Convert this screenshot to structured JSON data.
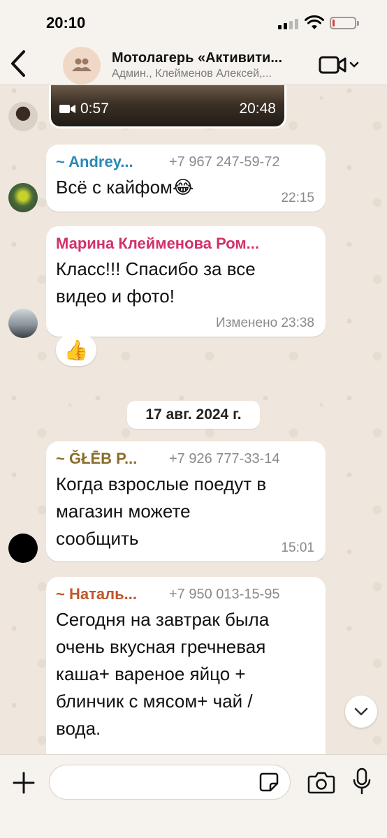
{
  "status_bar": {
    "time": "20:10",
    "battery_level": 0.1
  },
  "header": {
    "title": "Мотолагерь «Активити...",
    "subtitle": "Админ., Клейменов Алексей,..."
  },
  "colors": {
    "andrey": "#2a8ab5",
    "marina": "#d2306b",
    "gleb": "#8a6d2a",
    "natalya": "#c0562c"
  },
  "messages": [
    {
      "type": "video",
      "duration": "0:57",
      "time": "20:48"
    },
    {
      "sender": "~ Andrey...",
      "phone": "+7 967 247-59-72",
      "text": "Всё с кайфом😂",
      "time": "22:15"
    },
    {
      "sender": "Марина Клейменова Ром...",
      "text_lines": [
        "Класс!!! Спасибо за все",
        "видео и фото!"
      ],
      "time": "Изменено 23:38",
      "reaction": "👍"
    },
    {
      "sender": "~ ĞŁĒB P...",
      "phone": "+7 926 777-33-14",
      "text_lines": [
        "Когда взрослые поедут в",
        "магазин можете",
        "сообщить"
      ],
      "time": "15:01"
    },
    {
      "sender": "~ Наталь...",
      "phone": "+7 950 013-15-95",
      "text_lines": [
        "Сегодня на завтрак была",
        "очень вкусная гречневая",
        "каша+ вареное яйцо +",
        "блинчик с мясом+ чай /",
        "вода."
      ]
    }
  ],
  "date_separator": "17 авг. 2024 г.",
  "input": {
    "placeholder": "",
    "value": ""
  },
  "icons": {
    "back": "chevron-left-icon",
    "video_call": "video-camera-icon",
    "plus": "plus-icon",
    "sticker": "sticker-icon",
    "camera": "camera-icon",
    "mic": "microphone-icon",
    "scroll_down": "chevron-down-icon"
  }
}
